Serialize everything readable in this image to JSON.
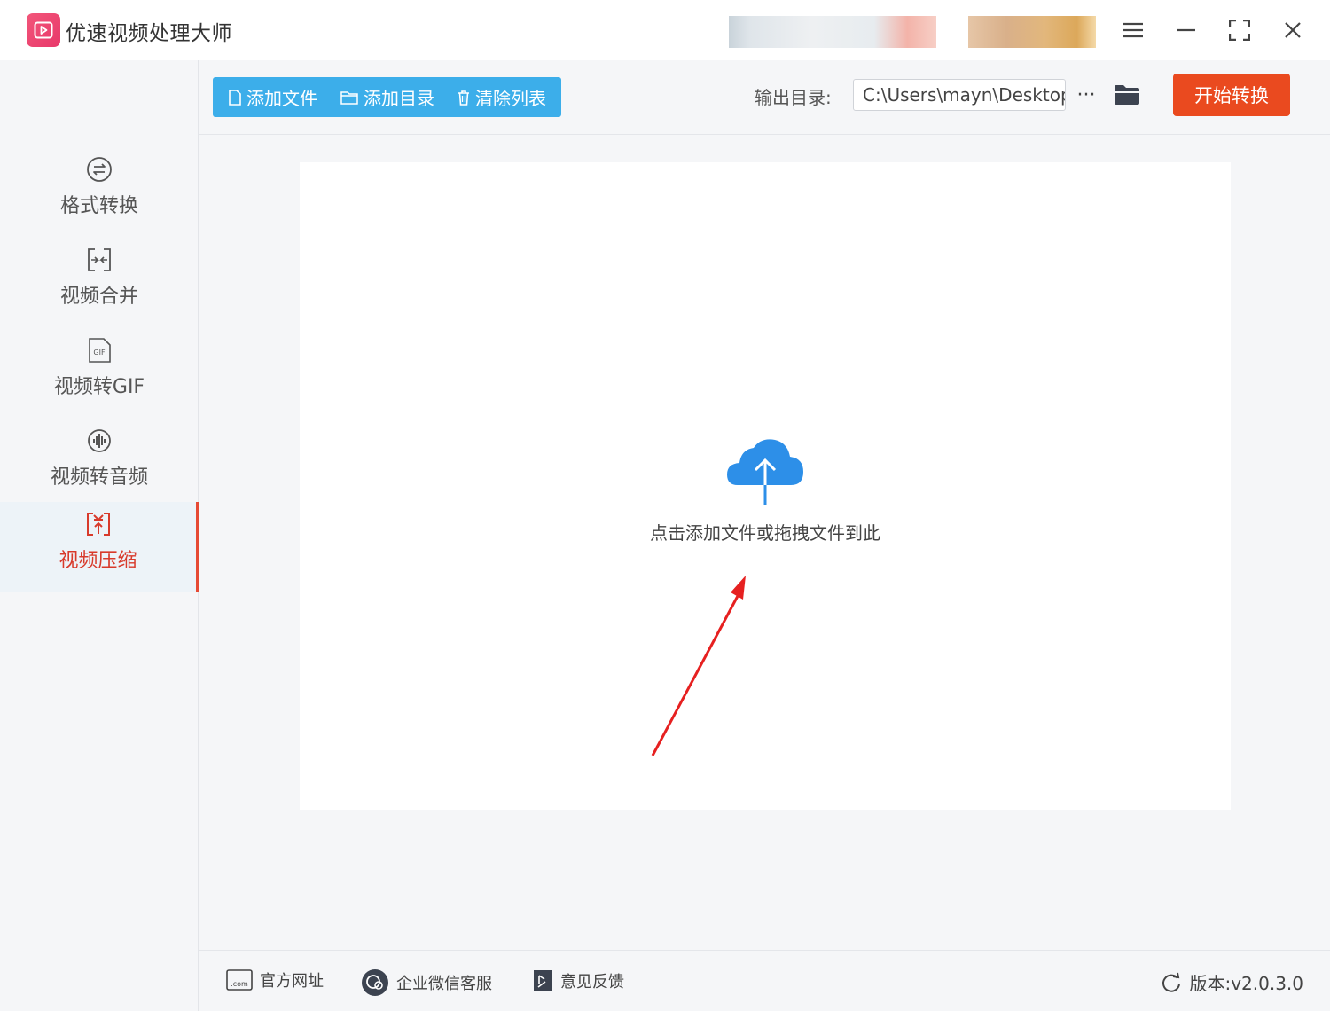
{
  "app": {
    "title": "优速视频处理大师",
    "accent_color": "#3caeea",
    "brand_color": "#e8386a",
    "start_color": "#ea4a1f"
  },
  "sidebar": {
    "items": [
      {
        "label": "格式转换",
        "icon": "format-convert-icon",
        "active": false
      },
      {
        "label": "视频合并",
        "icon": "merge-icon",
        "active": false
      },
      {
        "label": "视频转GIF",
        "icon": "gif-icon",
        "active": false
      },
      {
        "label": "视频转音频",
        "icon": "audio-icon",
        "active": false
      },
      {
        "label": "视频压缩",
        "icon": "compress-icon",
        "active": true
      }
    ]
  },
  "toolbar": {
    "add_file": "添加文件",
    "add_folder": "添加目录",
    "clear_list": "清除列表",
    "output_label": "输出目录:",
    "output_path": "C:\\Users\\mayn\\Desktop",
    "more": "···",
    "start": "开始转换"
  },
  "dropzone": {
    "hint": "点击添加文件或拖拽文件到此"
  },
  "footer": {
    "website": "官方网址",
    "wechat_support": "企业微信客服",
    "feedback": "意见反馈",
    "version": "版本:v2.0.3.0"
  }
}
